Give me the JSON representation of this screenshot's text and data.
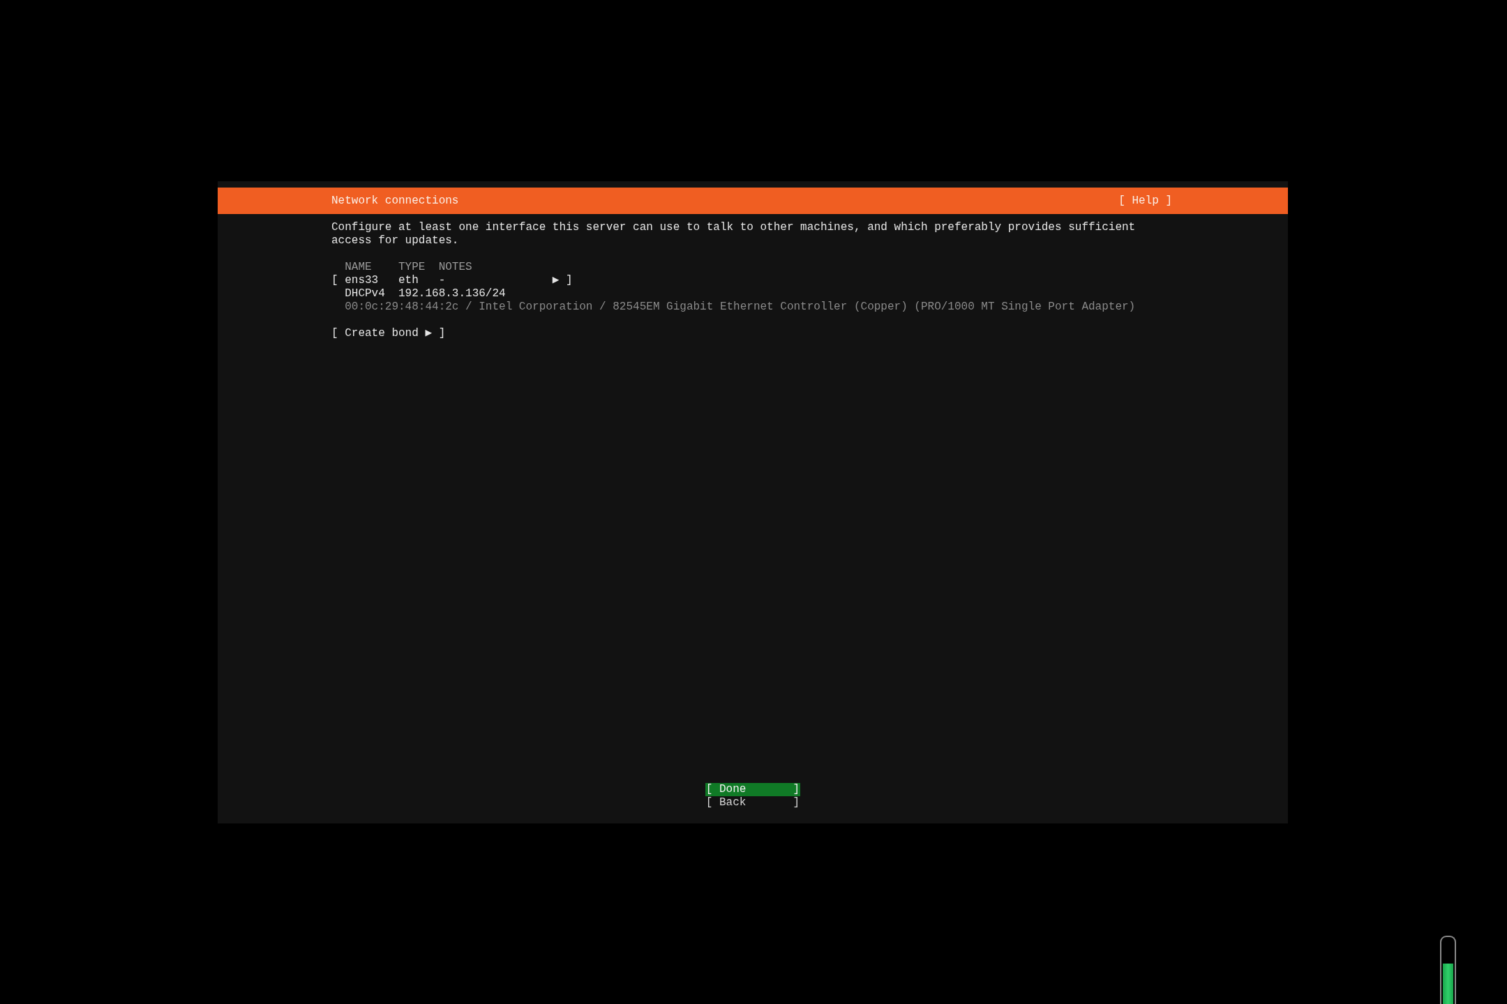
{
  "screen": {
    "title": "Network connections",
    "help": "[ Help ]"
  },
  "description": "Configure at least one interface this server can use to talk to other machines, and which preferably provides sufficient access for updates.",
  "table": {
    "columns": [
      "NAME",
      "TYPE",
      "NOTES"
    ],
    "interfaces": [
      {
        "open": "[",
        "name": "ens33",
        "type": "eth",
        "notes": "-",
        "menu": "▶ ]",
        "addresses": [
          {
            "method": "DHCPv4",
            "address": "192.168.3.136/24"
          }
        ],
        "hardware": "00:0c:29:48:44:2c / Intel Corporation / 82545EM Gigabit Ethernet Controller (Copper) (PRO/1000 MT Single Port Adapter)"
      }
    ]
  },
  "create_bond": "[ Create bond ▶ ]",
  "buttons": [
    {
      "open": "[",
      "label": "Done",
      "close": "]",
      "selected": true
    },
    {
      "open": "[",
      "label": "Back",
      "close": "]",
      "selected": false
    }
  ],
  "level_meter": {
    "level": 0.62
  }
}
